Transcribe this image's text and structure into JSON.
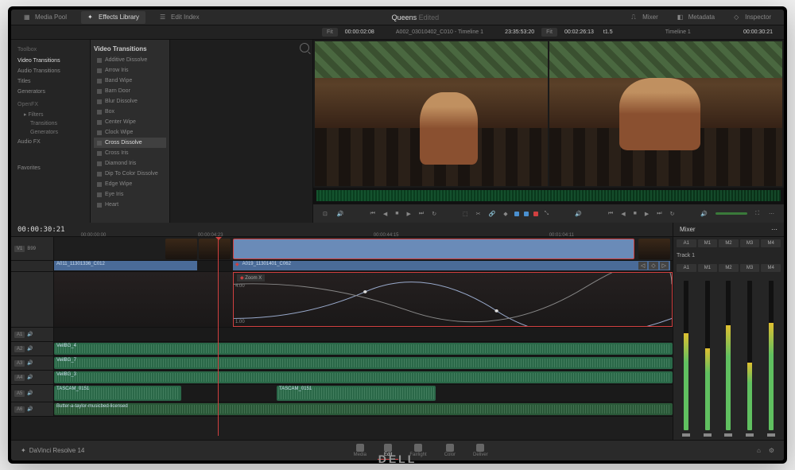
{
  "app": {
    "name": "DaVinci Resolve 14",
    "monitor_brand": "DELL"
  },
  "topbar": {
    "tabs": [
      {
        "label": "Media Pool",
        "icon": "media-pool-icon"
      },
      {
        "label": "Effects Library",
        "icon": "effects-icon"
      },
      {
        "label": "Edit Index",
        "icon": "edit-index-icon"
      }
    ],
    "active_tab": 1,
    "center_title": "Queens",
    "center_status": "Edited",
    "right_tabs": [
      {
        "label": "Mixer",
        "icon": "mixer-icon"
      },
      {
        "label": "Metadata",
        "icon": "metadata-icon"
      },
      {
        "label": "Inspector",
        "icon": "inspector-icon"
      }
    ]
  },
  "subheader": {
    "fit_left": "Fit",
    "tc_left": "00:00:02:08",
    "clip_name": "A002_03010402_C010 - Timeline 1",
    "tc_mid": "23:35:53:20",
    "fit_right": "Fit",
    "tc_right": "00:02:26:13",
    "pct": "t1.5",
    "timeline_name": "Timeline 1",
    "tc_end": "00:00:30:21"
  },
  "sidebar": {
    "header": "Toolbox",
    "groups": [
      {
        "label": "Video Transitions",
        "active": true
      },
      {
        "label": "Audio Transitions"
      },
      {
        "label": "Titles"
      },
      {
        "label": "Generators"
      }
    ],
    "openfx_header": "OpenFX",
    "openfx": [
      {
        "label": "Filters"
      },
      {
        "label": "Transitions"
      },
      {
        "label": "Generators"
      }
    ],
    "audiofx": "Audio FX",
    "favorites": "Favorites"
  },
  "effects": {
    "header": "Video Transitions",
    "items": [
      "Additive Dissolve",
      "Arrow Iris",
      "Band Wipe",
      "Barn Door",
      "Blur Dissolve",
      "Box",
      "Center Wipe",
      "Clock Wipe",
      "Cross Dissolve",
      "Cross Iris",
      "Diamond Iris",
      "Dip To Color Dissolve",
      "Edge Wipe",
      "Eye Iris",
      "Heart"
    ],
    "selected": 8
  },
  "transport": {
    "tc_left": "00:00:30:21",
    "marker_mode": "◆"
  },
  "timeline": {
    "main_tc": "00:00:30:21",
    "ruler": [
      "00:00:00:00",
      "00:00:04:23",
      "00:00:44:15",
      "00:01:04:11"
    ],
    "video_tracks": [
      {
        "id": "V1",
        "tag": "B99"
      }
    ],
    "clips": {
      "v1_a": "A011_11301336_C012",
      "v1_b": "A019_11301401_C062",
      "fx_name": "Zoom X",
      "fx_val_l": "4.00",
      "fx_val_r": "1.00"
    },
    "audio_tracks": [
      {
        "id": "A1",
        "label": ""
      },
      {
        "id": "A2",
        "label": "VeilBG_4"
      },
      {
        "id": "A3",
        "label": "VeilBG_7"
      },
      {
        "id": "A4",
        "label": "VeilBG_3"
      },
      {
        "id": "A5",
        "label": "TASCAM_0151"
      },
      {
        "id": "A6",
        "label": "Butter-a-taylor-musicbed-licensed"
      }
    ],
    "tascam2": "TASCAM_0151"
  },
  "mixer": {
    "title": "Mixer",
    "bus": [
      "A1",
      "M1",
      "M2",
      "M3",
      "M4"
    ],
    "track_title": "Track 1",
    "channels": [
      "A1",
      "M1",
      "M2",
      "M3",
      "M4"
    ],
    "levels": [
      65,
      55,
      70,
      45,
      72
    ]
  },
  "pages": {
    "items": [
      "Media",
      "Edit",
      "Fairlight",
      "Color",
      "Deliver"
    ],
    "active": 1
  }
}
